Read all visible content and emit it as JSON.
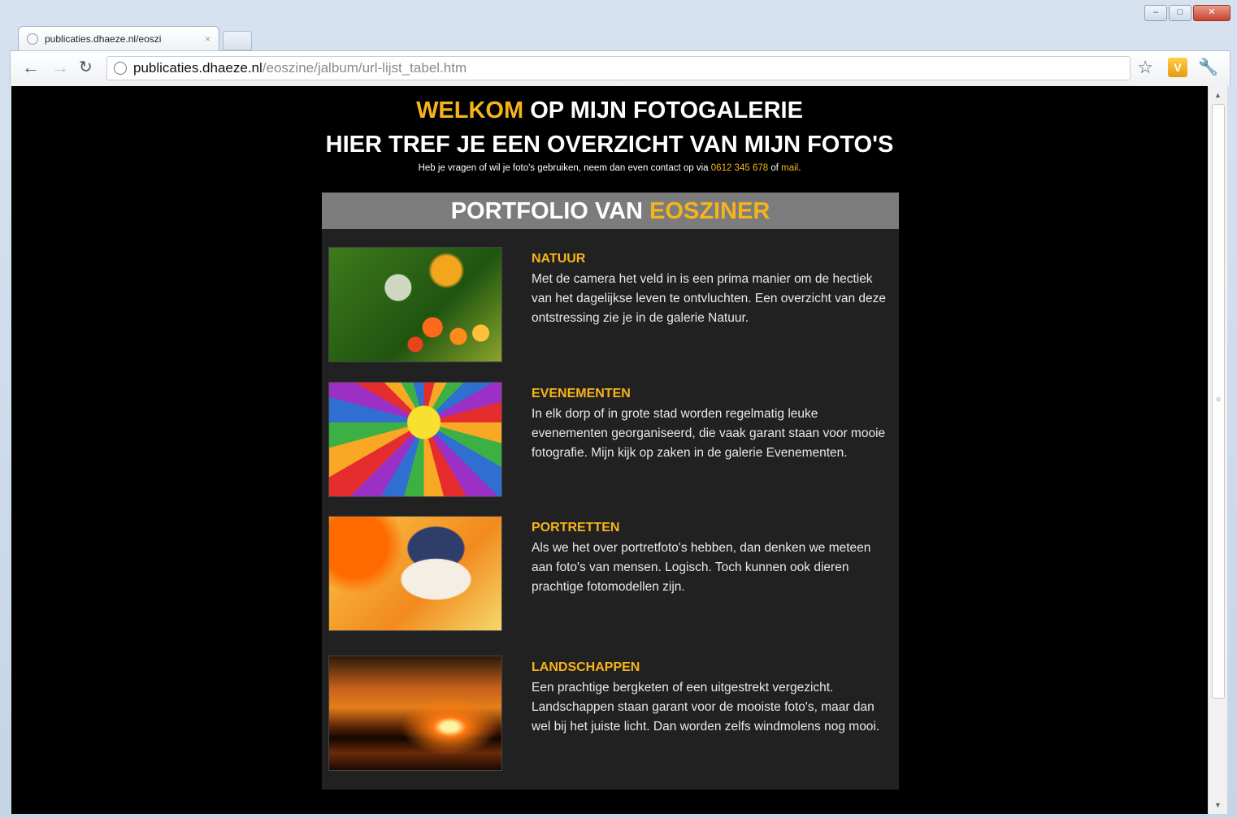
{
  "browser": {
    "tab_title": "publicaties.dhaeze.nl/eoszi",
    "tab_close": "×",
    "url_host": "publicaties.dhaeze.nl",
    "url_path": "/eoszine/jalbum/url-lijst_tabel.htm",
    "ext_badge": "V",
    "window_controls": {
      "minimize": "–",
      "maximize": "□",
      "close": "✕"
    }
  },
  "page": {
    "welcome_accent": "WELKOM",
    "welcome_rest": " OP MIJN FOTOGALERIE",
    "subtitle": "HIER TREF JE EEN OVERZICHT VAN MIJN FOTO'S",
    "contact_prefix": "Heb je vragen of wil je foto's gebruiken, neem dan even contact op via ",
    "contact_phone": "0612 345 678",
    "contact_mid": " of ",
    "contact_mail": "mail",
    "contact_suffix": ".",
    "portfolio_prefix": "PORTFOLIO VAN ",
    "portfolio_name": "EOSZINER",
    "entries": [
      {
        "title": "NATUUR",
        "text": "Met de camera het veld in is een prima manier om de hectiek van het dagelijkse leven te ontvluchten. Een overzicht van deze ontstressing zie je in de galerie Natuur."
      },
      {
        "title": "EVENEMENTEN",
        "text": "In elk dorp of in grote stad worden regelmatig leuke evenementen georganiseerd, die vaak garant staan voor mooie fotografie. Mijn kijk op zaken in de galerie Evenementen."
      },
      {
        "title": "PORTRETTEN",
        "text": "Als we het over portretfoto's hebben, dan denken we meteen aan foto's van mensen. Logisch. Toch kunnen ook dieren prachtige fotomodellen zijn."
      },
      {
        "title": "LANDSCHAPPEN",
        "text": "Een prachtige bergketen of een uitgestrekt vergezicht. Landschappen staan garant voor de mooiste foto's, maar dan wel bij het juiste licht. Dan worden zelfs windmolens nog mooi."
      }
    ]
  },
  "colors": {
    "accent": "#f6b41c",
    "panel": "#212121",
    "header": "#7c7c7c"
  }
}
